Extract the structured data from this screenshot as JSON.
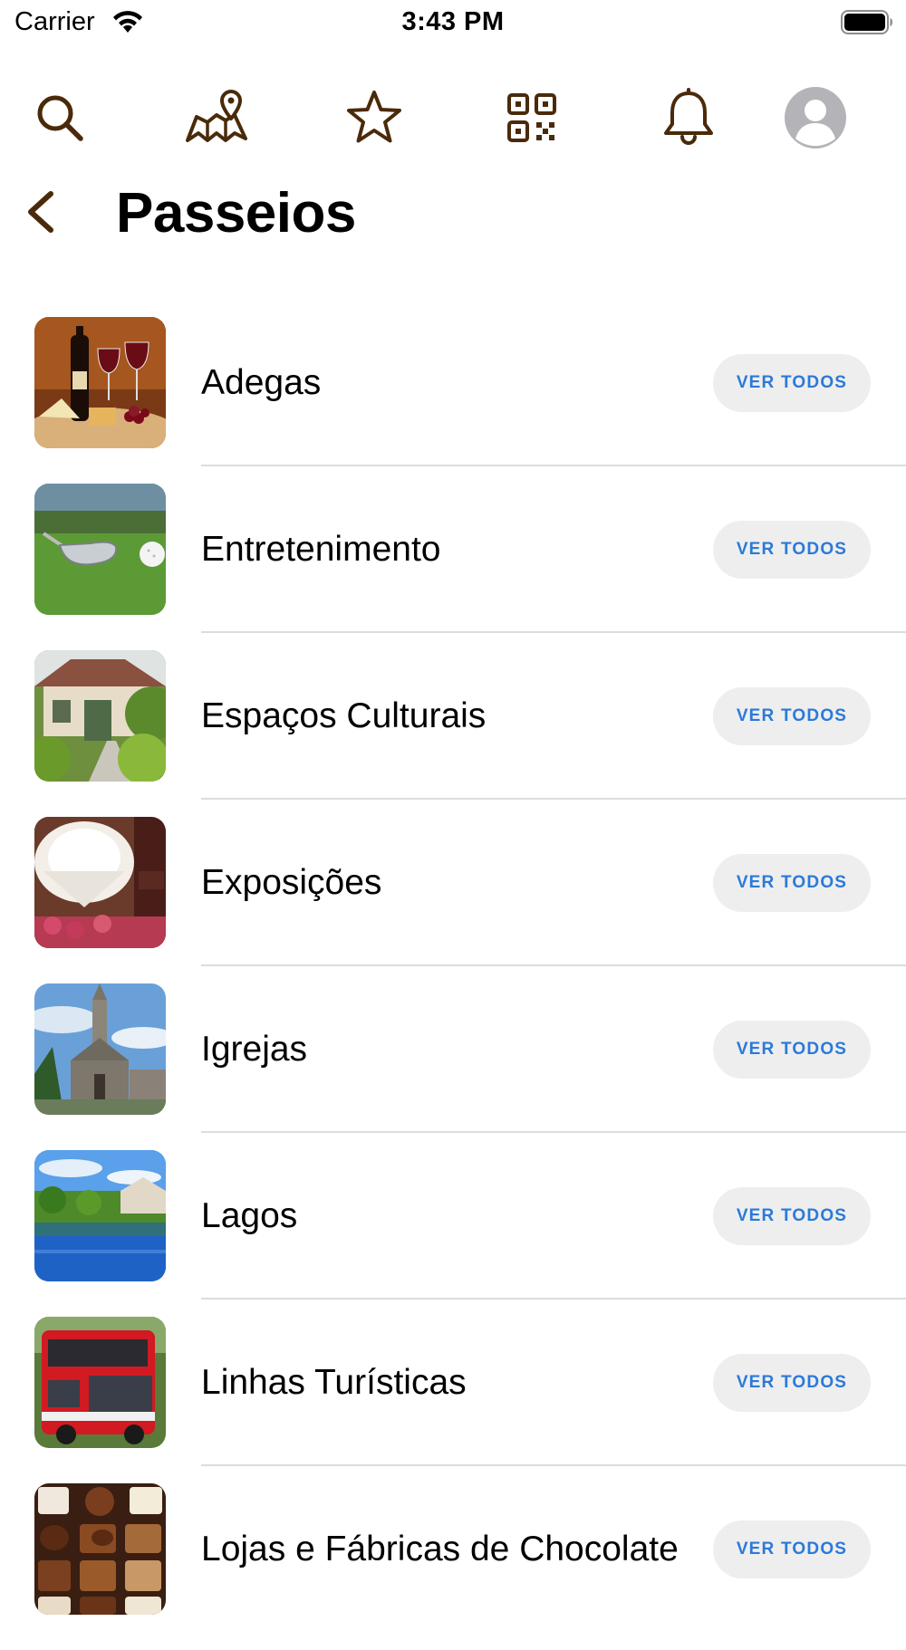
{
  "status_bar": {
    "carrier": "Carrier",
    "time": "3:43 PM"
  },
  "colors": {
    "icon_brown": "#4a2a0a",
    "button_text_blue": "#2a7ad8",
    "button_bg": "#eeeeef"
  },
  "top_bar": {
    "icons": [
      "search-icon",
      "map-pin-icon",
      "star-icon",
      "qr-code-icon",
      "bell-icon",
      "avatar-icon"
    ]
  },
  "header": {
    "title": "Passeios"
  },
  "list": {
    "items": [
      {
        "label": "Adegas",
        "button": "VER TODOS",
        "image": "wine-and-cheese-image"
      },
      {
        "label": "Entretenimento",
        "button": "VER TODOS",
        "image": "golf-image"
      },
      {
        "label": "Espaços Culturais",
        "button": "VER TODOS",
        "image": "cultural-house-image"
      },
      {
        "label": "Exposições",
        "button": "VER TODOS",
        "image": "chandelier-image"
      },
      {
        "label": "Igrejas",
        "button": "VER TODOS",
        "image": "church-image"
      },
      {
        "label": "Lagos",
        "button": "VER TODOS",
        "image": "lake-image"
      },
      {
        "label": "Linhas Turísticas",
        "button": "VER TODOS",
        "image": "red-bus-image"
      },
      {
        "label": "Lojas e Fábricas de Chocolate",
        "button": "VER TODOS",
        "image": "chocolates-image"
      }
    ]
  }
}
